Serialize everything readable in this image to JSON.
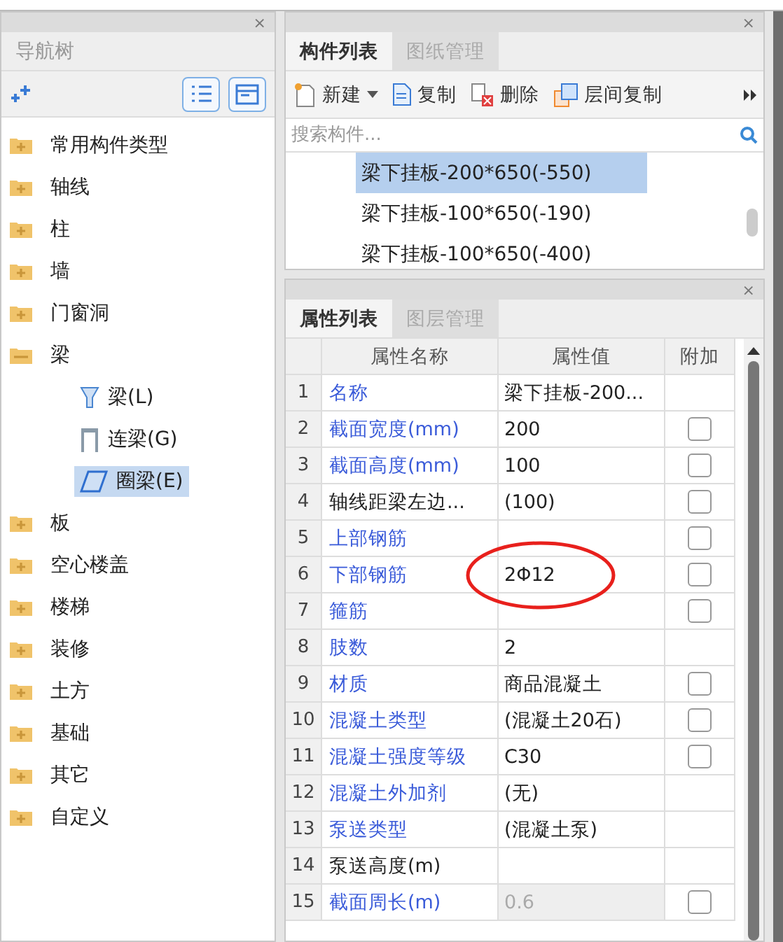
{
  "nav_panel": {
    "close": "×",
    "title": "导航树",
    "tree": [
      {
        "label": "常用构件类型",
        "expanded": false,
        "selected": false
      },
      {
        "label": "轴线",
        "expanded": false,
        "selected": false
      },
      {
        "label": "柱",
        "expanded": false,
        "selected": false
      },
      {
        "label": "墙",
        "expanded": false,
        "selected": false
      },
      {
        "label": "门窗洞",
        "expanded": false,
        "selected": false
      },
      {
        "label": "梁",
        "expanded": true,
        "selected": false,
        "children": [
          {
            "label": "梁(L)",
            "kind": "beam",
            "selected": false
          },
          {
            "label": "连梁(G)",
            "kind": "link",
            "selected": false
          },
          {
            "label": "圈梁(E)",
            "kind": "ring",
            "selected": true
          }
        ]
      },
      {
        "label": "板",
        "expanded": false,
        "selected": false
      },
      {
        "label": "空心楼盖",
        "expanded": false,
        "selected": false
      },
      {
        "label": "楼梯",
        "expanded": false,
        "selected": false
      },
      {
        "label": "装修",
        "expanded": false,
        "selected": false
      },
      {
        "label": "土方",
        "expanded": false,
        "selected": false
      },
      {
        "label": "基础",
        "expanded": false,
        "selected": false
      },
      {
        "label": "其它",
        "expanded": false,
        "selected": false
      },
      {
        "label": "自定义",
        "expanded": false,
        "selected": false
      }
    ]
  },
  "component_panel": {
    "close": "×",
    "tabs": [
      {
        "label": "构件列表",
        "selected": true
      },
      {
        "label": "图纸管理",
        "selected": false
      }
    ],
    "toolbar": [
      {
        "label": "新建",
        "kind": "new"
      },
      {
        "label": "复制",
        "kind": "copy"
      },
      {
        "label": "删除",
        "kind": "delete"
      },
      {
        "label": "层间复制",
        "kind": "floorcopy"
      }
    ],
    "search": {
      "placeholder": "搜索构件..."
    },
    "items": [
      {
        "label": "梁下挂板-200*650(-550)",
        "selected": true
      },
      {
        "label": "梁下挂板-100*650(-190)",
        "selected": false
      },
      {
        "label": "梁下挂板-100*650(-400)",
        "selected": false
      }
    ]
  },
  "property_panel": {
    "close": "×",
    "tabs": [
      {
        "label": "属性列表",
        "selected": true
      },
      {
        "label": "图层管理",
        "selected": false
      }
    ],
    "columns": [
      "属性名称",
      "属性值",
      "附加"
    ],
    "rows": [
      {
        "index": "1",
        "name": "名称",
        "value": "梁下挂板-200...",
        "linked": true,
        "kind": "plain",
        "disabled": false
      },
      {
        "index": "2",
        "name": "截面宽度(mm)",
        "value": "200",
        "linked": true,
        "kind": "checkbox",
        "checked": false,
        "disabled": false
      },
      {
        "index": "3",
        "name": "截面高度(mm)",
        "value": "100",
        "linked": true,
        "kind": "checkbox",
        "checked": false,
        "disabled": false
      },
      {
        "index": "4",
        "name": "轴线距梁左边...",
        "value": "(100)",
        "linked": false,
        "kind": "checkbox",
        "checked": false,
        "disabled": false
      },
      {
        "index": "5",
        "name": "上部钢筋",
        "value": "",
        "linked": true,
        "kind": "checkbox",
        "checked": false,
        "disabled": false
      },
      {
        "index": "6",
        "name": "下部钢筋",
        "value": "2Φ12",
        "linked": true,
        "kind": "checkbox",
        "checked": false,
        "disabled": false,
        "circled": true
      },
      {
        "index": "7",
        "name": "箍筋",
        "value": "",
        "linked": true,
        "kind": "checkbox",
        "checked": false,
        "disabled": false
      },
      {
        "index": "8",
        "name": "肢数",
        "value": "2",
        "linked": true,
        "kind": "plain",
        "disabled": false
      },
      {
        "index": "9",
        "name": "材质",
        "value": "商品混凝土",
        "linked": true,
        "kind": "checkbox",
        "checked": false,
        "disabled": false
      },
      {
        "index": "10",
        "name": "混凝土类型",
        "value": "(混凝土20石)",
        "linked": true,
        "kind": "checkbox",
        "checked": false,
        "disabled": false
      },
      {
        "index": "11",
        "name": "混凝土强度等级",
        "value": "C30",
        "linked": true,
        "kind": "checkbox",
        "checked": false,
        "disabled": false
      },
      {
        "index": "12",
        "name": "混凝土外加剂",
        "value": "(无)",
        "linked": true,
        "kind": "plain",
        "disabled": false
      },
      {
        "index": "13",
        "name": "泵送类型",
        "value": "(混凝土泵)",
        "linked": true,
        "kind": "plain",
        "disabled": false
      },
      {
        "index": "14",
        "name": "泵送高度(m)",
        "value": "",
        "linked": false,
        "kind": "plain",
        "disabled": false
      },
      {
        "index": "15",
        "name": "截面周长(m)",
        "value": "0.6",
        "linked": true,
        "kind": "checkbox",
        "checked": false,
        "disabled": true
      }
    ]
  }
}
